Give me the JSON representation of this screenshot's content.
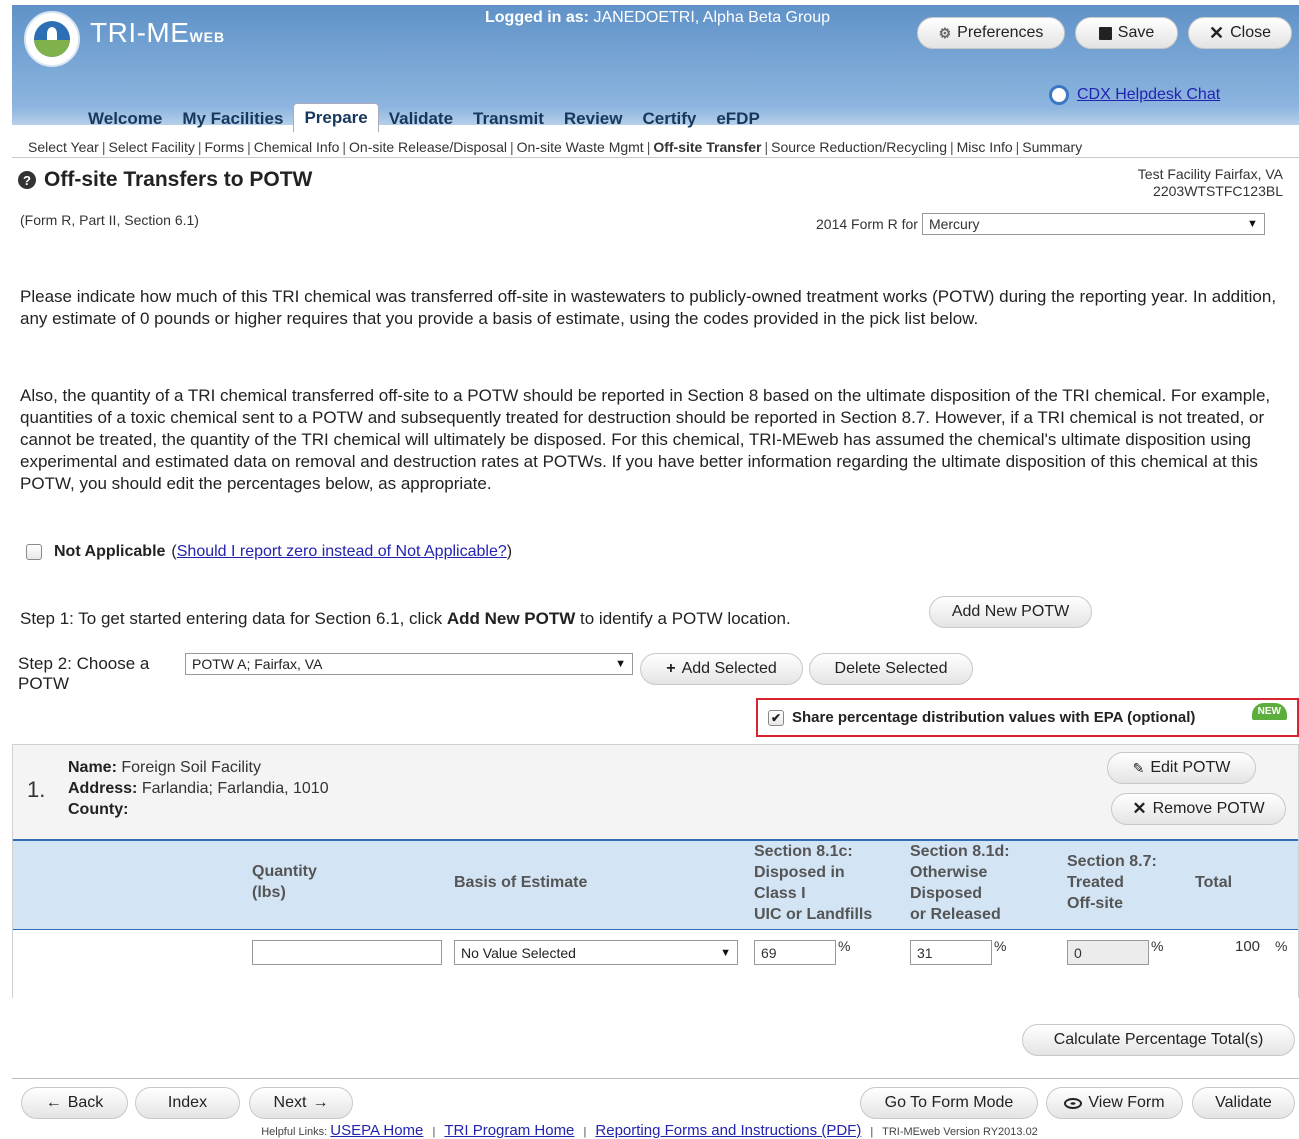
{
  "header": {
    "app_name": "TRI-ME",
    "app_name_sub": "WEB",
    "logged_in_label": "Logged in as:",
    "logged_in_value": "JANEDOETRI, Alpha Beta Group",
    "preferences_label": "Preferences",
    "save_label": "Save",
    "close_label": "Close",
    "helpdesk_label": "CDX Helpdesk Chat"
  },
  "nav": {
    "tabs": [
      "Welcome",
      "My Facilities",
      "Prepare",
      "Validate",
      "Transmit",
      "Review",
      "Certify",
      "eFDP"
    ],
    "active": "Prepare"
  },
  "subnav": {
    "items": [
      "Select Year",
      "Select Facility",
      "Forms",
      "Chemical Info",
      "On-site Release/Disposal",
      "On-site Waste Mgmt",
      "Off-site Transfer",
      "Source Reduction/Recycling",
      "Misc Info",
      "Summary"
    ],
    "active": "Off-site Transfer"
  },
  "page": {
    "title": "Off-site Transfers to POTW",
    "form_ref": "(Form R, Part II, Section 6.1)",
    "facility_name": "Test Facility Fairfax, VA",
    "facility_id": "2203WTSTFC123BL",
    "form_for_label": "2014 Form R for",
    "chemical": "Mercury",
    "para1": "Please indicate how much of this TRI chemical was transferred off-site in wastewaters to publicly-owned treatment works (POTW) during the reporting year. In addition, any estimate of 0 pounds or higher requires that you provide a basis of estimate, using the codes provided in the pick list below.",
    "para2": "Also, the quantity of a TRI chemical transferred off-site to a POTW should be reported in Section 8 based on the ultimate disposition of the TRI chemical. For example, quantities of a toxic chemical sent to a POTW and subsequently treated for destruction should be reported in Section 8.7. However, if a TRI chemical is not treated, or cannot be treated, the quantity of the TRI chemical will ultimately be disposed. For this chemical, TRI-MEweb has assumed the chemical's ultimate disposition using experimental and estimated data on removal and destruction rates at POTWs. If you have better information regarding the ultimate disposition of this chemical at this POTW, you should edit the percentages below, as appropriate.",
    "not_applicable_label": "Not Applicable",
    "not_applicable_link": "Should I report zero instead of Not Applicable?",
    "step1_prefix": "Step 1: To get started entering data for Section 6.1, click",
    "step1_bold": "Add New POTW",
    "step1_suffix": "to identify a POTW location.",
    "add_new_potw": "Add New POTW",
    "step2_label": "Step 2: Choose a POTW",
    "potw_selected": "POTW A; Fairfax, VA",
    "add_selected": "Add Selected",
    "delete_selected": "Delete Selected",
    "share_label": "Share percentage distribution values with EPA (optional)",
    "share_checked": true,
    "new_badge": "NEW"
  },
  "potw": {
    "number": "1.",
    "name_label": "Name:",
    "name": "Foreign Soil Facility",
    "address_label": "Address:",
    "address": "Farlandia; Farlandia,  1010",
    "county_label": "County:",
    "county": "",
    "edit_label": "Edit POTW",
    "remove_label": "Remove POTW"
  },
  "table": {
    "headers": {
      "quantity": [
        "Quantity",
        "(lbs)"
      ],
      "basis": "Basis of Estimate",
      "s81c": [
        "Section 8.1c:",
        "Disposed in",
        "Class I",
        "UIC or Landfills"
      ],
      "s81d": [
        "Section 8.1d:",
        "Otherwise",
        "Disposed",
        "or Released"
      ],
      "s87": [
        "Section 8.7:",
        "Treated",
        "Off-site"
      ],
      "total": "Total"
    },
    "row": {
      "quantity": "",
      "basis": "No Value Selected",
      "s81c": "69",
      "s81d": "31",
      "s87": "0",
      "total": "100",
      "pct": "%"
    }
  },
  "actions": {
    "calculate": "Calculate Percentage Total(s)",
    "back": "Back",
    "index": "Index",
    "next": "Next",
    "go_form_mode": "Go To Form Mode",
    "view_form": "View Form",
    "validate": "Validate"
  },
  "footer": {
    "prefix": "Helpful Links:",
    "links": [
      "USEPA Home",
      "TRI Program Home",
      "Reporting Forms and Instructions (PDF)"
    ],
    "version": "TRI-MEweb Version RY2013.02"
  }
}
